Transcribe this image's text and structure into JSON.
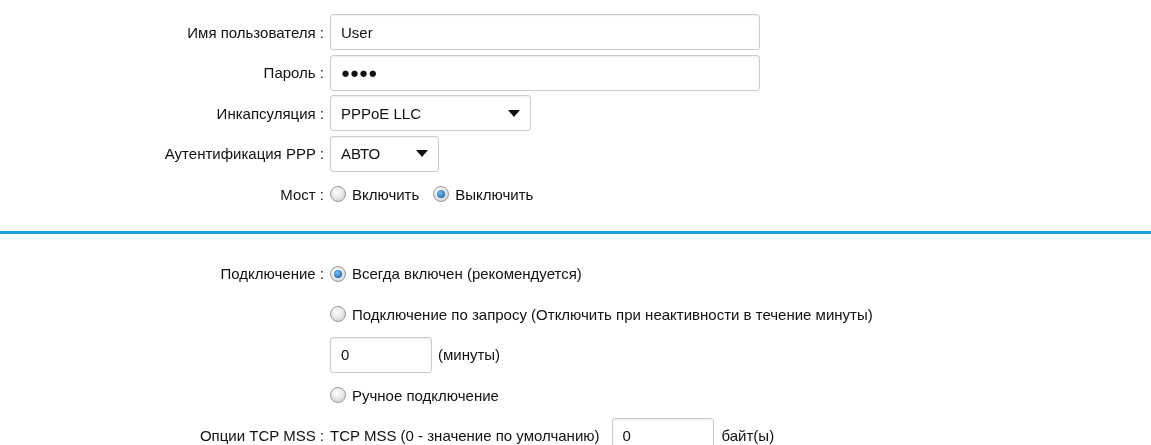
{
  "account": {
    "username": {
      "label": "Имя пользователя :",
      "value": "User"
    },
    "password": {
      "label": "Пароль :",
      "value": "●●●●"
    },
    "encapsulation": {
      "label": "Инкапсуляция :",
      "value": "PPPoE LLC"
    },
    "ppp_auth": {
      "label": "Аутентификация PPP :",
      "value": "АВТО"
    },
    "bridge": {
      "label": "Мост :",
      "options": [
        {
          "label": "Включить",
          "selected": false
        },
        {
          "label": "Выключить",
          "selected": true
        }
      ]
    }
  },
  "connection": {
    "label": "Подключение :",
    "options": [
      {
        "label": "Всегда включен (рекомендуется)",
        "selected": true
      },
      {
        "label": "Подключение по запросу (Отключить при неактивности в течение минуты)",
        "selected": false
      },
      {
        "label": "Ручное подключение",
        "selected": false
      }
    ],
    "idle_minutes": {
      "value": "0",
      "unit": "(минуты)"
    }
  },
  "tcp_mss": {
    "label": "Опции TCP MSS :",
    "text": "TCP MSS (0 - значение по умолчанию)",
    "value": "0",
    "unit": "байт(ы)"
  }
}
